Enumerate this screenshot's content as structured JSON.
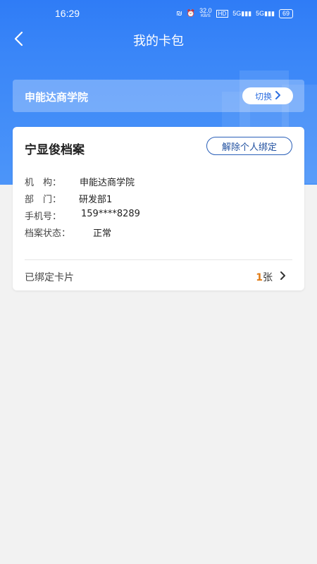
{
  "status_bar": {
    "time": "16:29",
    "net_speed_top": "32.0",
    "net_speed_unit": "KB/S",
    "hd_label": "HD",
    "network_1": "5G",
    "network_2": "5G",
    "battery": "69"
  },
  "navbar": {
    "title": "我的卡包",
    "back_icon": "chevron-left-icon"
  },
  "org_switch": {
    "org_name": "申能达商学院",
    "switch_label": "切换"
  },
  "profile_card": {
    "name": "宁显俊档案",
    "unbind_label": "解除个人绑定",
    "fields": [
      {
        "label": "机　构：",
        "value": "申能达商学院"
      },
      {
        "label": "部　门：",
        "value": "研发部1"
      },
      {
        "label": "手机号：",
        "value": "159****8289"
      },
      {
        "label": "档案状态：",
        "value": "正常"
      }
    ],
    "bound_cards_label": "已绑定卡片",
    "bound_count": "1",
    "bound_unit": "张"
  },
  "colors": {
    "header_blue": "#2f7cf6",
    "accent_orange": "#e07b16",
    "button_border": "#2a5fb8"
  }
}
